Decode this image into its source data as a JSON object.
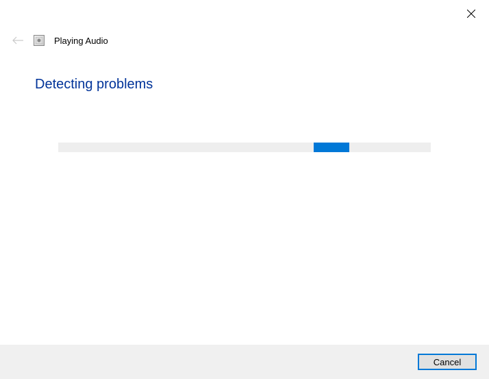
{
  "header": {
    "title": "Playing Audio"
  },
  "main": {
    "heading": "Detecting problems"
  },
  "footer": {
    "cancel_label": "Cancel"
  }
}
